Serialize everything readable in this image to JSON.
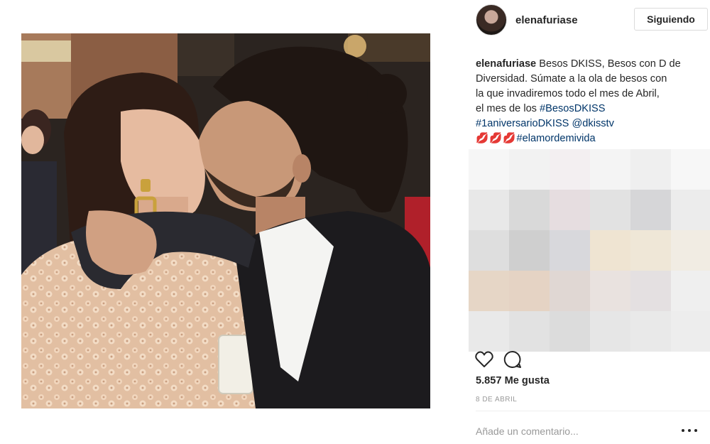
{
  "post": {
    "photo_icon": "kiss-photo",
    "author": {
      "username": "elenafuriase",
      "avatar_icon": "avatar-image",
      "follow_label": "Siguiendo"
    },
    "caption": {
      "username": "elenafuriase",
      "line1_text": " Besos DKISS, Besos con D de",
      "line2_text": "Diversidad. Súmate a la ola de besos con",
      "line3_text": "la que invadiremos todo el mes de Abril,",
      "line4_text": "el mes de los ",
      "hashtag_besos": "#BesosDKISS",
      "hashtag_aniversario": "#1aniversarioDKISS",
      "mention_dkisstv": "@dkisstv",
      "lips_emoji": "💋💋💋",
      "hashtag_elamor": "#elamordemivida"
    },
    "comments_icon": "pixelated-comments",
    "actions": {
      "like_icon": "heart-icon",
      "comment_icon": "comment-icon"
    },
    "likes_text": "5.857 Me gusta",
    "date_text": "8 DE ABRIL",
    "comment_placeholder": "Añade un comentario...",
    "more_icon": "more-options-icon"
  }
}
